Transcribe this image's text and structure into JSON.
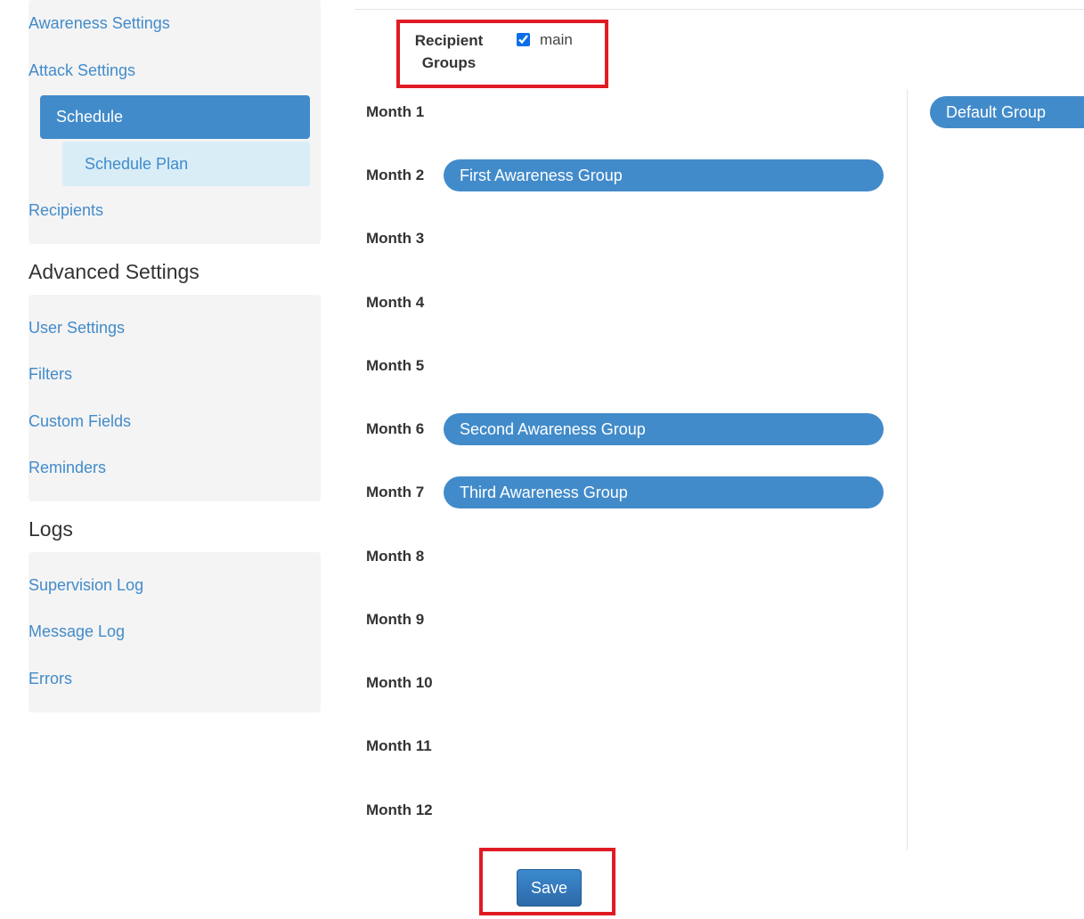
{
  "sidebar": {
    "setup_items": [
      {
        "label": "Awareness Settings"
      },
      {
        "label": "Attack Settings"
      },
      {
        "label": "Schedule",
        "active": true
      },
      {
        "label": "Schedule Plan",
        "sub": true
      },
      {
        "label": "Recipients"
      }
    ],
    "advanced": {
      "heading": "Advanced Settings",
      "items": [
        {
          "label": "User Settings"
        },
        {
          "label": "Filters"
        },
        {
          "label": "Custom Fields"
        },
        {
          "label": "Reminders"
        }
      ]
    },
    "logs": {
      "heading": "Logs",
      "items": [
        {
          "label": "Supervision Log"
        },
        {
          "label": "Message Log"
        },
        {
          "label": "Errors"
        }
      ]
    }
  },
  "recipient_groups": {
    "label": "Recipient Groups",
    "options": [
      {
        "label": "main",
        "checked": true
      }
    ]
  },
  "schedule": {
    "months": [
      {
        "label": "Month 1",
        "group": null
      },
      {
        "label": "Month 2",
        "group": "First Awareness Group"
      },
      {
        "label": "Month 3",
        "group": null
      },
      {
        "label": "Month 4",
        "group": null
      },
      {
        "label": "Month 5",
        "group": null
      },
      {
        "label": "Month 6",
        "group": "Second Awareness Group"
      },
      {
        "label": "Month 7",
        "group": "Third Awareness Group"
      },
      {
        "label": "Month 8",
        "group": null
      },
      {
        "label": "Month 9",
        "group": null
      },
      {
        "label": "Month 10",
        "group": null
      },
      {
        "label": "Month 11",
        "group": null
      },
      {
        "label": "Month 12",
        "group": null
      }
    ],
    "available_groups": [
      "Default Group"
    ]
  },
  "actions": {
    "save_label": "Save"
  },
  "colors": {
    "primary": "#428bca",
    "active_sub_bg": "#d9edf7",
    "panel_bg": "#f4f4f4",
    "highlight": "#e01b24"
  }
}
